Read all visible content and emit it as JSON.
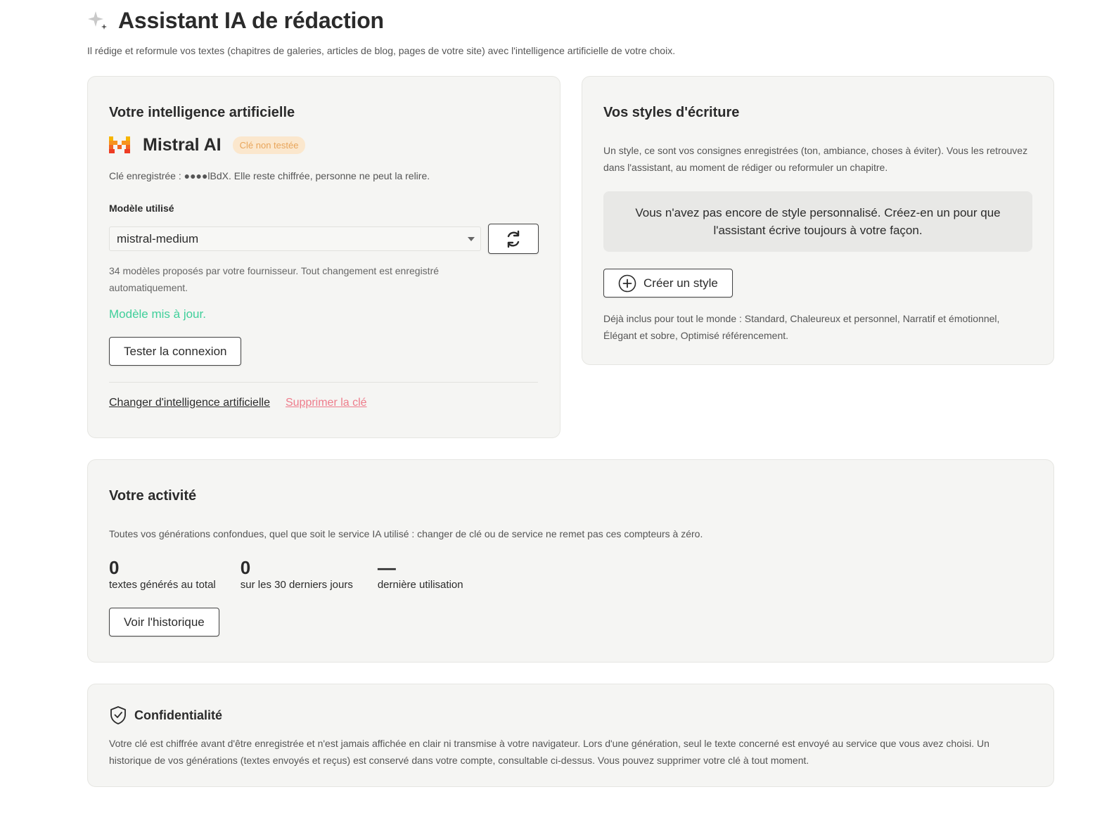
{
  "header": {
    "title": "Assistant IA de rédaction",
    "subtitle": "Il rédige et reformule vos textes (chapitres de galeries, articles de blog, pages de votre site) avec l'intelligence artificielle de votre choix."
  },
  "ai_card": {
    "title": "Votre intelligence artificielle",
    "provider": "Mistral AI",
    "badge": "Clé non testée",
    "key_line": "Clé enregistrée : ●●●●lBdX. Elle reste chiffrée, personne ne peut la relire.",
    "model_label": "Modèle utilisé",
    "model_value": "mistral-medium",
    "model_hint": "34 modèles proposés par votre fournisseur. Tout changement est enregistré automatiquement.",
    "success": "Modèle mis à jour.",
    "test_button": "Tester la connexion",
    "change_link": "Changer d'intelligence artificielle",
    "delete_link": "Supprimer la clé"
  },
  "styles_card": {
    "title": "Vos styles d'écriture",
    "description": "Un style, ce sont vos consignes enregistrées (ton, ambiance, choses à éviter). Vous les retrouvez dans l'assistant, au moment de rédiger ou reformuler un chapitre.",
    "empty_message": "Vous n'avez pas encore de style personnalisé. Créez-en un pour que l'assistant écrive toujours à votre façon.",
    "create_button": "Créer un style",
    "included": "Déjà inclus pour tout le monde : Standard, Chaleureux et personnel, Narratif et émotionnel, Élégant et sobre, Optimisé référencement."
  },
  "activity_card": {
    "title": "Votre activité",
    "description": "Toutes vos générations confondues, quel que soit le service IA utilisé : changer de clé ou de service ne remet pas ces compteurs à zéro.",
    "stats": [
      {
        "value": "0",
        "label": "textes générés au total"
      },
      {
        "value": "0",
        "label": "sur les 30 derniers jours"
      },
      {
        "value": "—",
        "label": "dernière utilisation"
      }
    ],
    "history_button": "Voir l'historique"
  },
  "privacy_card": {
    "title": "Confidentialité",
    "text": "Votre clé est chiffrée avant d'être enregistrée et n'est jamais affichée en clair ni transmise à votre navigateur. Lors d'une génération, seul le texte concerné est envoyé au service que vous avez choisi. Un historique de vos générations (textes envoyés et reçus) est conservé dans votre compte, consultable ci-dessus. Vous pouvez supprimer votre clé à tout moment."
  },
  "icons": {
    "title": "sparkle-icon",
    "provider": "mistral-logo",
    "refresh": "refresh-icon",
    "create": "plus-circle-icon",
    "privacy": "shield-check-icon"
  },
  "colors": {
    "card_background": "#f5f5f3",
    "badge_background": "#fbe7cd",
    "badge_text": "#e8a55a",
    "success": "#3fcf9a",
    "danger_link": "#ee7c8b",
    "mistral_orange": "#f7931e"
  }
}
